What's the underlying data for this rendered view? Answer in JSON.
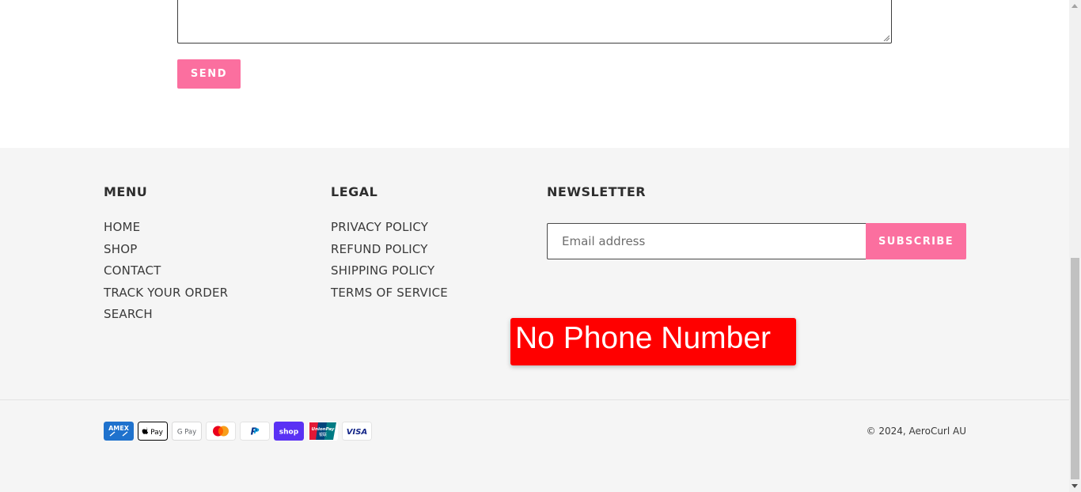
{
  "form": {
    "message_value": "",
    "send_label": "SEND"
  },
  "footer": {
    "menu": {
      "title": "MENU",
      "items": [
        "HOME",
        "SHOP",
        "CONTACT",
        "TRACK YOUR ORDER",
        "SEARCH"
      ]
    },
    "legal": {
      "title": "LEGAL",
      "items": [
        "PRIVACY POLICY",
        "REFUND POLICY",
        "SHIPPING POLICY",
        "TERMS OF SERVICE"
      ]
    },
    "newsletter": {
      "title": "NEWSLETTER",
      "email_placeholder": "Email address",
      "subscribe_label": "SUBSCRIBE"
    },
    "annotation_text": "No Phone Number",
    "payments": [
      {
        "name": "american-express-icon",
        "label": "AMEX"
      },
      {
        "name": "apple-pay-icon",
        "label": "Pay"
      },
      {
        "name": "google-pay-icon",
        "label": "G Pay"
      },
      {
        "name": "mastercard-icon",
        "label": ""
      },
      {
        "name": "paypal-icon",
        "label": "P"
      },
      {
        "name": "shop-pay-icon",
        "label": "shop"
      },
      {
        "name": "union-pay-icon",
        "label": "UnionPay"
      },
      {
        "name": "visa-icon",
        "label": "VISA"
      }
    ],
    "copyright": "© 2024, AeroCurl AU"
  },
  "colors": {
    "accent": "#fb6f9f",
    "footer_bg": "#f5f5f5",
    "annotation": "#ff0000"
  }
}
